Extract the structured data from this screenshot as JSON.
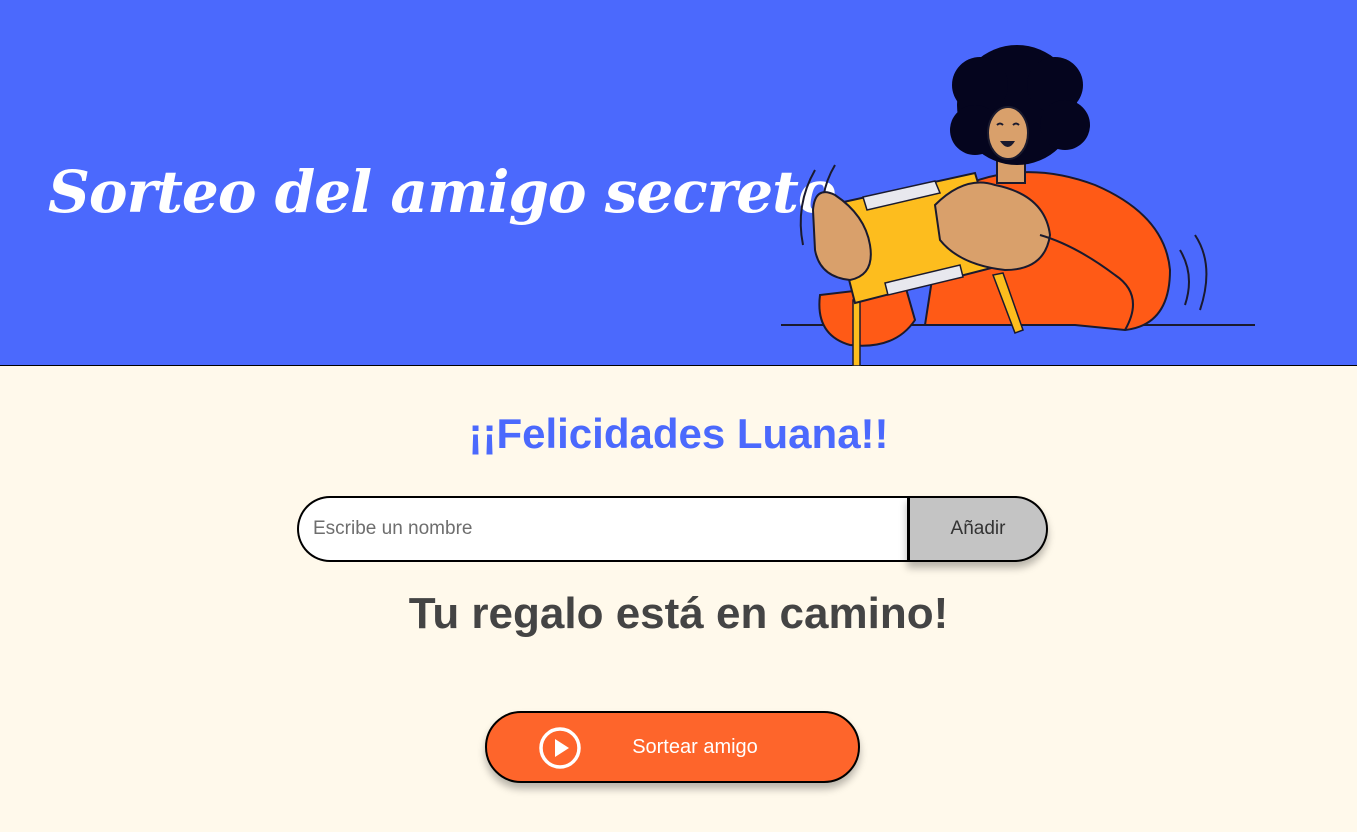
{
  "header": {
    "title": "Sorteo del amigo secreto",
    "illustration": "person-holding-gift-illustration"
  },
  "main": {
    "subtitle": "¡¡Felicidades Luana!!",
    "name_input": {
      "placeholder": "Escribe un nombre",
      "value": ""
    },
    "add_button_label": "Añadir",
    "result_text": "Tu regalo está en camino!",
    "draw_button": {
      "label": "Sortear amigo",
      "icon": "play-circle-icon"
    }
  },
  "colors": {
    "header_bg": "#4B69FD",
    "page_bg": "#FFF9EB",
    "accent_orange": "#FE652B",
    "subtitle_blue": "#4B69FD",
    "add_button_bg": "#C4C4C4",
    "text_dark": "#444444"
  }
}
